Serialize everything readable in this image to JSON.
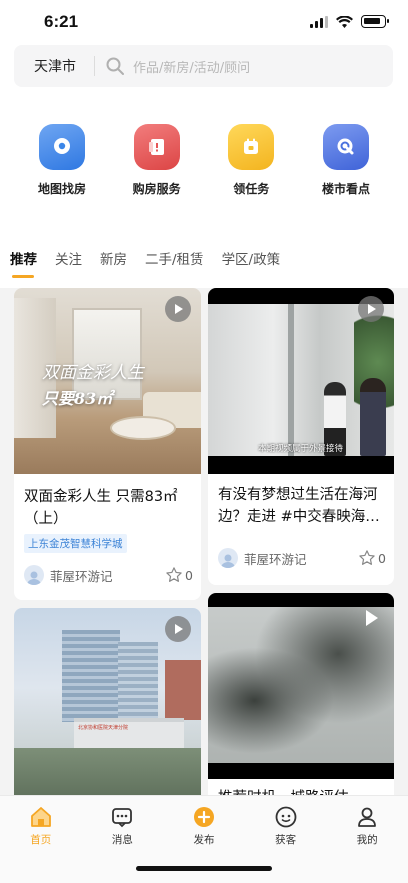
{
  "status_bar": {
    "time": "6:21"
  },
  "search": {
    "city": "天津市",
    "placeholder": "作品/新房/活动/顾问"
  },
  "quick_actions": [
    {
      "label": "地图找房",
      "icon": "map-pin-icon",
      "color": "#3b86e8"
    },
    {
      "label": "购房服务",
      "icon": "document-icon",
      "color": "#e65656"
    },
    {
      "label": "领任务",
      "icon": "calendar-icon",
      "color": "#f4c02d"
    },
    {
      "label": "楼市看点",
      "icon": "search-icon",
      "color": "#4a72de"
    }
  ],
  "tabs": [
    {
      "label": "推荐",
      "active": true
    },
    {
      "label": "关注"
    },
    {
      "label": "新房"
    },
    {
      "label": "二手/租赁"
    },
    {
      "label": "学区/政策"
    }
  ],
  "feed": {
    "left_card_1": {
      "image_text_line1": "双面金彩人生",
      "image_text_line2": "只要83㎡",
      "title": "双面金彩人生 只需83㎡（上）",
      "tag": "上东金茂智慧科学城",
      "author": "菲屋环游记",
      "likes": "0"
    },
    "right_card_1": {
      "image_caption": "本期视频属于外景接待",
      "title": "有没有梦想过生活在海河边？走进 #中交春映海…",
      "author": "菲屋环游记",
      "likes": "0"
    },
    "left_card_2": {
      "image_sign": "北京协和医院天津分院"
    },
    "right_card_2": {
      "title": "推荐时机，城路评估…"
    }
  },
  "bottom_nav": [
    {
      "label": "首页",
      "icon": "home-icon",
      "active": true
    },
    {
      "label": "消息",
      "icon": "message-icon"
    },
    {
      "label": "发布",
      "icon": "publish-icon"
    },
    {
      "label": "获客",
      "icon": "customer-icon"
    },
    {
      "label": "我的",
      "icon": "profile-icon"
    }
  ],
  "colors": {
    "accent": "#f5a623",
    "tag_blue": "#3c83d6"
  }
}
